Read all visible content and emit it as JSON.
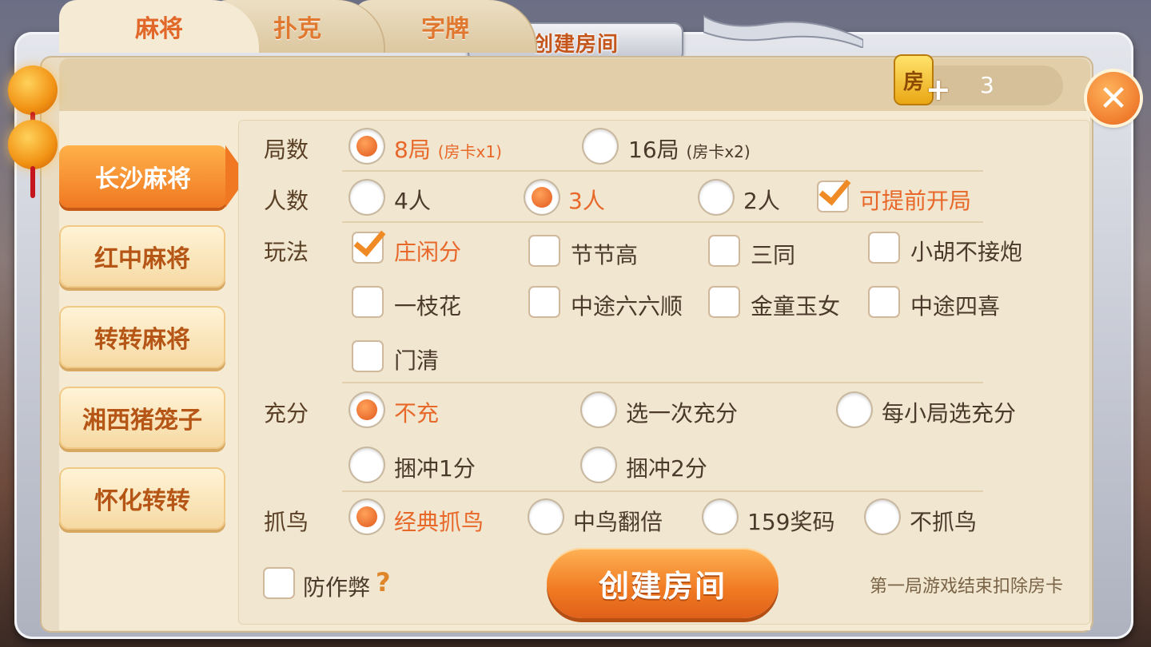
{
  "title": "创建房间",
  "tabs": [
    {
      "label": "麻将",
      "active": true
    },
    {
      "label": "扑克",
      "active": false
    },
    {
      "label": "字牌",
      "active": false
    }
  ],
  "room_card": {
    "icon_char": "房",
    "plus": "+",
    "count": "3"
  },
  "close_symbol": "✕",
  "games": [
    {
      "label": "长沙麻将",
      "active": true
    },
    {
      "label": "红中麻将",
      "active": false
    },
    {
      "label": "转转麻将",
      "active": false
    },
    {
      "label": "湘西猪笼子",
      "active": false
    },
    {
      "label": "怀化转转",
      "active": false
    }
  ],
  "rounds": {
    "label": "局数",
    "options": [
      {
        "text": "8局",
        "note": "(房卡x1)",
        "selected": true
      },
      {
        "text": "16局",
        "note": "(房卡x2)",
        "selected": false
      }
    ]
  },
  "players": {
    "label": "人数",
    "options": [
      {
        "text": "4人",
        "selected": false
      },
      {
        "text": "3人",
        "selected": true
      },
      {
        "text": "2人",
        "selected": false
      }
    ],
    "early_start": {
      "text": "可提前开局",
      "checked": true
    }
  },
  "rules": {
    "label": "玩法",
    "options": [
      {
        "text": "庄闲分",
        "checked": true
      },
      {
        "text": "节节高",
        "checked": false
      },
      {
        "text": "三同",
        "checked": false
      },
      {
        "text": "小胡不接炮",
        "checked": false
      },
      {
        "text": "一枝花",
        "checked": false
      },
      {
        "text": "中途六六顺",
        "checked": false
      },
      {
        "text": "金童玉女",
        "checked": false
      },
      {
        "text": "中途四喜",
        "checked": false
      },
      {
        "text": "门清",
        "checked": false
      }
    ]
  },
  "charge": {
    "label": "充分",
    "options": [
      {
        "text": "不充",
        "selected": true
      },
      {
        "text": "选一次充分",
        "selected": false
      },
      {
        "text": "每小局选充分",
        "selected": false
      },
      {
        "text": "捆冲1分",
        "selected": false
      },
      {
        "text": "捆冲2分",
        "selected": false
      }
    ]
  },
  "bird": {
    "label": "抓鸟",
    "options": [
      {
        "text": "经典抓鸟",
        "selected": true
      },
      {
        "text": "中鸟翻倍",
        "selected": false
      },
      {
        "text": "159奖码",
        "selected": false
      },
      {
        "text": "不抓鸟",
        "selected": false
      }
    ]
  },
  "anti_cheat": {
    "text": "防作弊",
    "checked": false,
    "help": "?"
  },
  "create_button": "创建房间",
  "footer_note": "第一局游戏结束扣除房卡",
  "colors": {
    "accent": "#e8682a",
    "text": "#4a3a2a",
    "panel": "#f1e6cf"
  }
}
